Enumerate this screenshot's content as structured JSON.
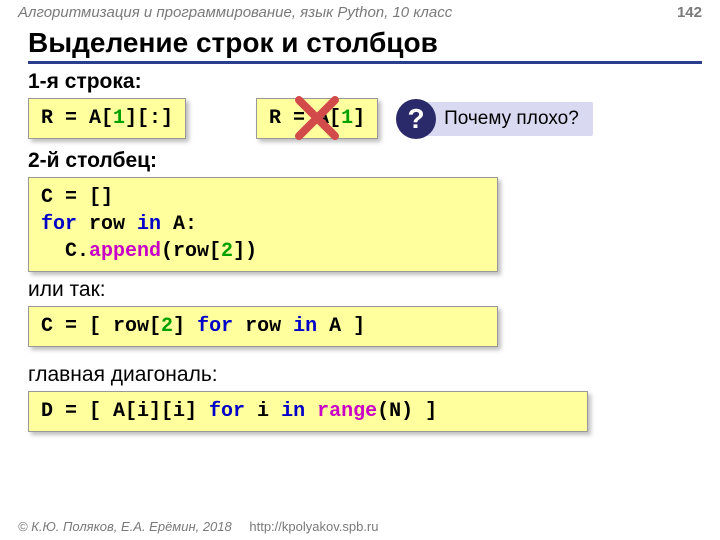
{
  "header": {
    "course": "Алгоритмизация и программирование, язык Python, 10 класс",
    "page": "142"
  },
  "title": "Выделение строк и столбцов",
  "labels": {
    "row1": "1-я строка:",
    "col2": "2-й столбец:",
    "or": "или так:",
    "diag": "главная диагональ:"
  },
  "code": {
    "good_row_pre": "R = A[",
    "good_row_idx": "1",
    "good_row_post": "][:]",
    "bad_row_pre": "R = A[",
    "bad_row_idx": "1",
    "bad_row_post": "]",
    "col_block_l1": "C = []",
    "col_block_l2_kw1": "for",
    "col_block_l2_mid": " row ",
    "col_block_l2_kw2": "in",
    "col_block_l2_end": " A:",
    "col_block_l3_pre": "  C.",
    "col_block_l3_fn": "append",
    "col_block_l3_mid": "(row[",
    "col_block_l3_idx": "2",
    "col_block_l3_end": "])",
    "colcomp_pre": "C = [ row[",
    "colcomp_idx": "2",
    "colcomp_mid1": "] ",
    "colcomp_kw1": "for",
    "colcomp_mid2": " row ",
    "colcomp_kw2": "in",
    "colcomp_end": " A ]",
    "diag_pre": "D = [ A[i][i] ",
    "diag_kw1": "for",
    "diag_mid1": " i ",
    "diag_kw2": "in",
    "diag_mid2": " ",
    "diag_fn": "range",
    "diag_end": "(N) ]"
  },
  "bubble": {
    "mark": "?",
    "text": "Почему плохо?"
  },
  "footer": {
    "copy": "© К.Ю. Поляков, Е.А. Ерёмин, 2018",
    "url": "http://kpolyakov.spb.ru"
  }
}
